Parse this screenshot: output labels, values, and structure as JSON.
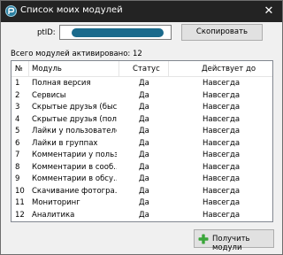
{
  "window": {
    "title": "Список моих модулей"
  },
  "ptid": {
    "label": "ptID:",
    "value": ""
  },
  "copy_button": {
    "label": "Скопировать"
  },
  "summary": {
    "text": "Всего модулей активировано: 12"
  },
  "table": {
    "headers": {
      "num": "№",
      "module": "Модуль",
      "status": "Статус",
      "valid": "Действует до"
    },
    "rows": [
      {
        "num": "1",
        "module": "Полная версия",
        "status": "Да",
        "valid": "Навсегда"
      },
      {
        "num": "2",
        "module": "Сервисы",
        "status": "Да",
        "valid": "Навсегда"
      },
      {
        "num": "3",
        "module": "Скрытые друзья (быс...",
        "status": "Да",
        "valid": "Навсегда"
      },
      {
        "num": "4",
        "module": "Скрытые друзья (пол...",
        "status": "Да",
        "valid": "Навсегда"
      },
      {
        "num": "5",
        "module": "Лайки у пользователей",
        "status": "Да",
        "valid": "Навсегда"
      },
      {
        "num": "6",
        "module": "Лайки в группах",
        "status": "Да",
        "valid": "Навсегда"
      },
      {
        "num": "7",
        "module": "Комментарии у польз...",
        "status": "Да",
        "valid": "Навсегда"
      },
      {
        "num": "8",
        "module": "Комментарии в сооб...",
        "status": "Да",
        "valid": "Навсегда"
      },
      {
        "num": "9",
        "module": "Комментарии в обсу...",
        "status": "Да",
        "valid": "Навсегда"
      },
      {
        "num": "10",
        "module": "Скачивание фотогра...",
        "status": "Да",
        "valid": "Навсегда"
      },
      {
        "num": "11",
        "module": "Мониторинг",
        "status": "Да",
        "valid": "Навсегда"
      },
      {
        "num": "12",
        "module": "Аналитика",
        "status": "Да",
        "valid": "Навсегда"
      }
    ]
  },
  "get_modules_button": {
    "label": "Получить модули",
    "icon": "plus-icon"
  },
  "colors": {
    "titlebar": "#232323",
    "redaction": "#1a6a8c",
    "plus_icon": "#3aa63a"
  }
}
